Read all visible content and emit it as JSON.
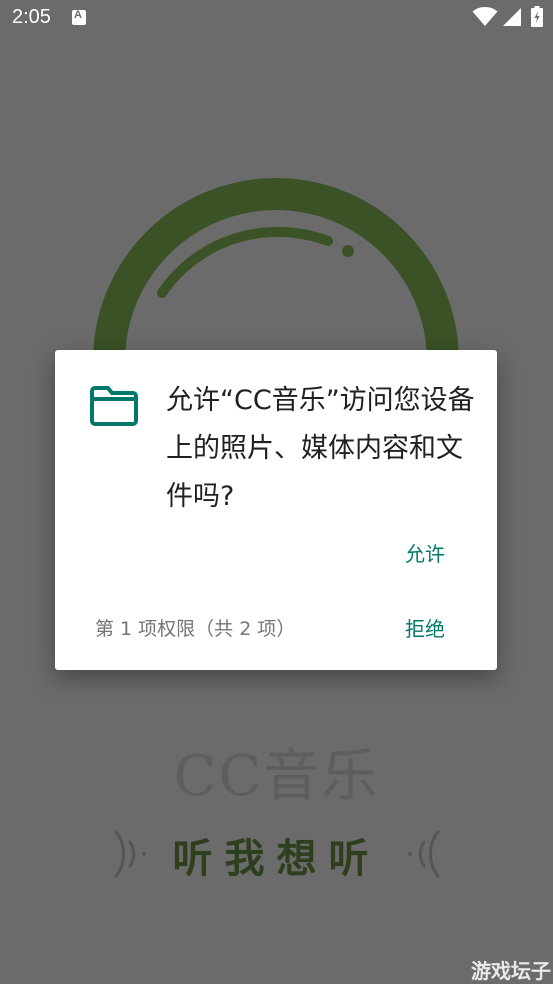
{
  "status_bar": {
    "time": "2:05",
    "icons": [
      "notification-a-icon",
      "wifi-icon",
      "signal-icon",
      "battery-icon"
    ]
  },
  "splash": {
    "app_name": "CC音乐",
    "tagline": "听我想听",
    "colors": {
      "logo_green": "#3a5226",
      "overlay": "#6b6b6b"
    }
  },
  "dialog": {
    "icon": "folder-icon",
    "message": "允许“CC音乐”访问您设备上的照片、媒体内容和文件吗?",
    "allow_label": "允许",
    "deny_label": "拒绝",
    "counter": "第 1 项权限（共 2 项）",
    "accent_color": "#00796b"
  },
  "watermark": "游戏坛子"
}
